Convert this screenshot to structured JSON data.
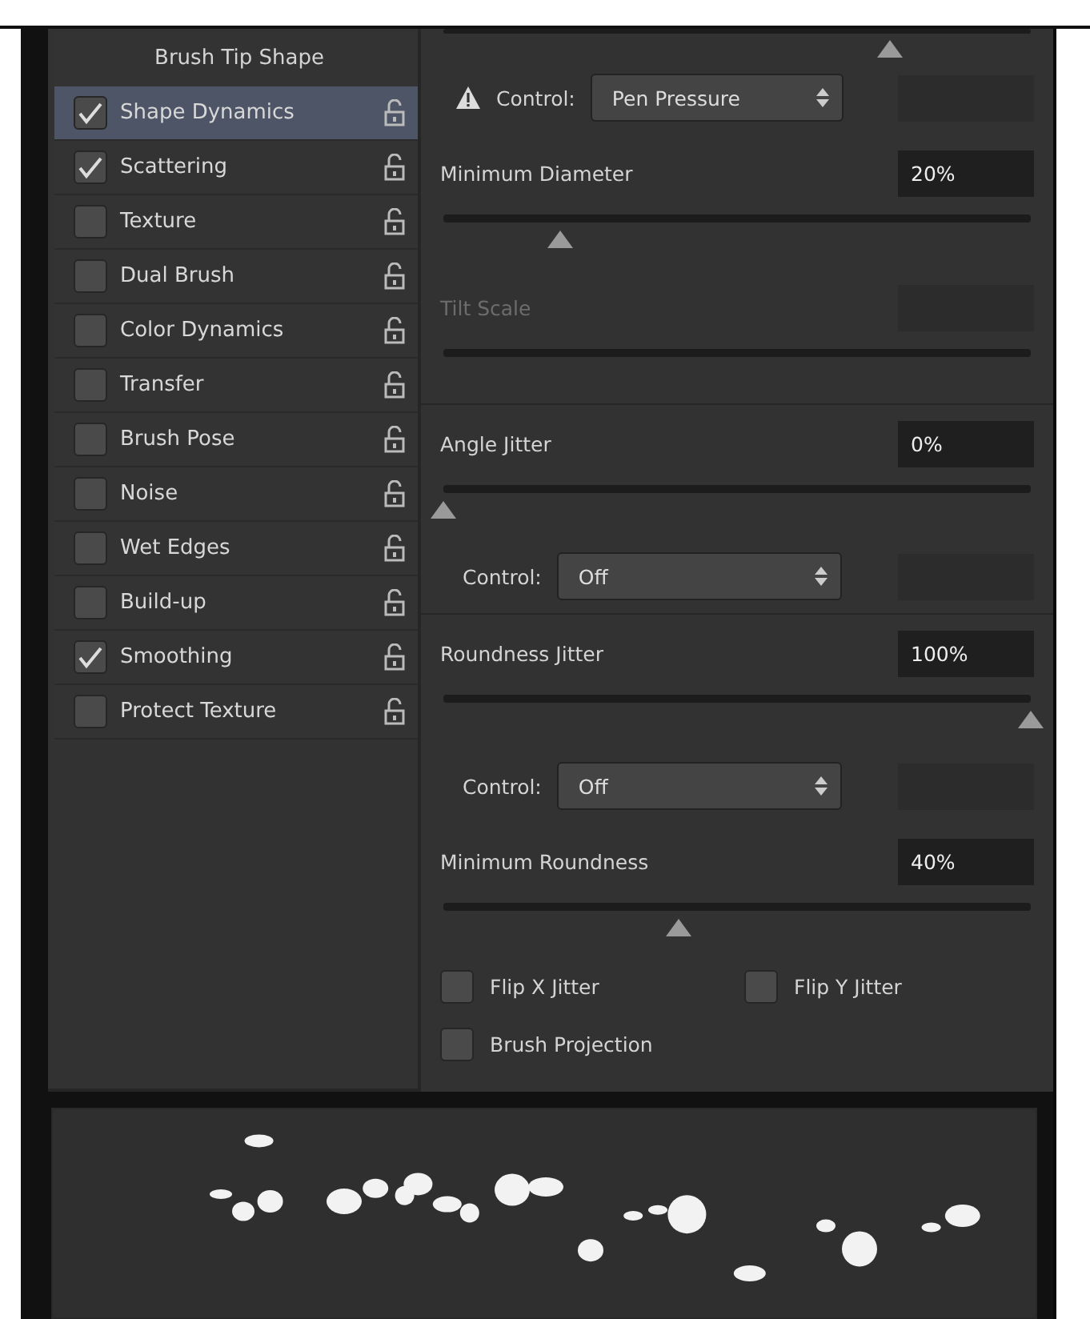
{
  "brush_settings": {
    "items": [
      {
        "kind": "header",
        "label": "Brush Tip Shape"
      },
      {
        "kind": "option",
        "label": "Shape Dynamics",
        "checked": true,
        "selected": true
      },
      {
        "kind": "option",
        "label": "Scattering",
        "checked": true,
        "selected": false
      },
      {
        "kind": "option",
        "label": "Texture",
        "checked": false,
        "selected": false
      },
      {
        "kind": "option",
        "label": "Dual Brush",
        "checked": false,
        "selected": false
      },
      {
        "kind": "option",
        "label": "Color Dynamics",
        "checked": false,
        "selected": false
      },
      {
        "kind": "option",
        "label": "Transfer",
        "checked": false,
        "selected": false
      },
      {
        "kind": "option",
        "label": "Brush Pose",
        "checked": false,
        "selected": false
      },
      {
        "kind": "option",
        "label": "Noise",
        "checked": false,
        "selected": false
      },
      {
        "kind": "option",
        "label": "Wet Edges",
        "checked": false,
        "selected": false
      },
      {
        "kind": "option",
        "label": "Build-up",
        "checked": false,
        "selected": false
      },
      {
        "kind": "option",
        "label": "Smoothing",
        "checked": true,
        "selected": false
      },
      {
        "kind": "option",
        "label": "Protect Texture",
        "checked": false,
        "selected": false
      }
    ]
  },
  "top_slider": {
    "level": 0.76
  },
  "settings": [
    {
      "kind": "control",
      "warning": true,
      "label": "Control:",
      "value": "Pen Pressure"
    },
    {
      "kind": "slider",
      "label": "Minimum Diameter",
      "value": "20%",
      "level": 0.2,
      "disabled": false
    },
    {
      "kind": "slider",
      "label": "Tilt Scale",
      "disabled": true
    },
    {
      "kind": "divider"
    },
    {
      "kind": "slider",
      "label": "Angle Jitter",
      "value": "0%",
      "level": 0,
      "disabled": false
    },
    {
      "kind": "control",
      "warning": false,
      "label": "Control:",
      "value": "Off"
    },
    {
      "kind": "divider"
    },
    {
      "kind": "slider",
      "label": "Roundness Jitter",
      "value": "100%",
      "level": 1,
      "disabled": false
    },
    {
      "kind": "control",
      "warning": false,
      "label": "Control:",
      "value": "Off"
    },
    {
      "kind": "slider",
      "label": "Minimum Roundness",
      "value": "40%",
      "level": 0.4,
      "disabled": false
    }
  ],
  "checkbox_rows": [
    [
      {
        "label": "Flip X Jitter",
        "checked": false
      },
      {
        "label": "Flip Y Jitter",
        "checked": false
      }
    ],
    [
      {
        "label": "Brush Projection",
        "checked": false
      }
    ]
  ]
}
